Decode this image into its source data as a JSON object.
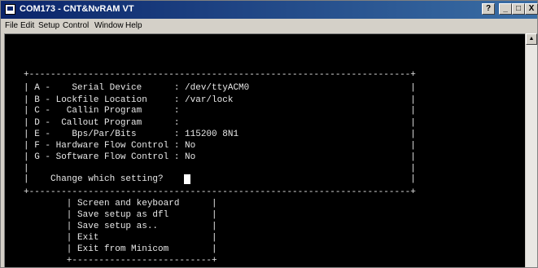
{
  "window": {
    "title": "COM173 - CNT&NvRAM VT",
    "controls": {
      "help": "?",
      "minimize": "_",
      "maximize": "□",
      "close": "X"
    }
  },
  "menu": [
    "File",
    "Edit",
    "Setup",
    "Control",
    "Window",
    "Help"
  ],
  "terminal": {
    "lines": [
      "+-----------------------------------------------------------------------+",
      "| A -    Serial Device      : /dev/ttyACM0                              |",
      "| B - Lockfile Location     : /var/lock                                 |",
      "| C -   Callin Program      :                                           |",
      "| D -  Callout Program      :                                           |",
      "| E -    Bps/Par/Bits       : 115200 8N1                                |",
      "| F - Hardware Flow Control : No                                        |",
      "| G - Software Flow Control : No                                        |",
      "|                                                                       |",
      "|    Change which setting?                                              |",
      "+-----------------------------------------------------------------------+",
      "        | Screen and keyboard      |",
      "        | Save setup as dfl        |",
      "        | Save setup as..          |",
      "        | Exit                     |",
      "        | Exit from Minicom        |",
      "        +--------------------------+"
    ]
  }
}
